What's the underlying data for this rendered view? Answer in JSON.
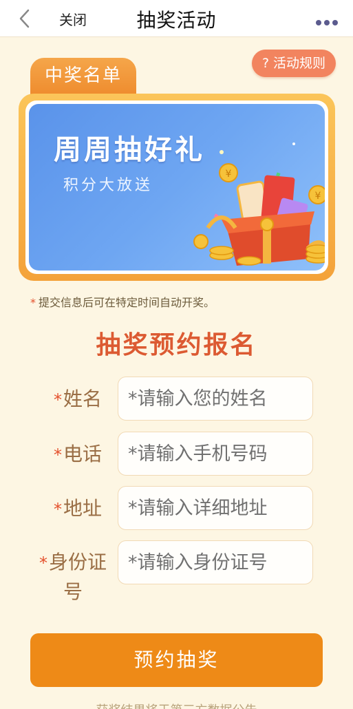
{
  "navbar": {
    "close_label": "关闭",
    "title": "抽奖活动"
  },
  "rules_button": "? 活动规则",
  "winners_tab": "中奖名单",
  "banner": {
    "title": "周周抽好礼",
    "subtitle": "积分大放送"
  },
  "note": {
    "star": "*",
    "text": "提交信息后可在特定时间自动开奖。"
  },
  "form": {
    "title": "抽奖预约报名",
    "required_mark": "*",
    "fields": [
      {
        "label": "姓名",
        "placeholder": "*请输入您的姓名"
      },
      {
        "label": "电话",
        "placeholder": "*请输入手机号码"
      },
      {
        "label": "地址",
        "placeholder": "*请输入详细地址"
      },
      {
        "label": "身份证号",
        "placeholder": "*请输入身份证号"
      }
    ],
    "submit_label": "预约抽奖"
  },
  "footer_text": "获奖结果将于第三方数据公告",
  "colors": {
    "accent_orange": "#ee8a17",
    "title_red": "#dc5a32",
    "banner_blue": "#5a93ea",
    "background": "#fdf6e3"
  }
}
